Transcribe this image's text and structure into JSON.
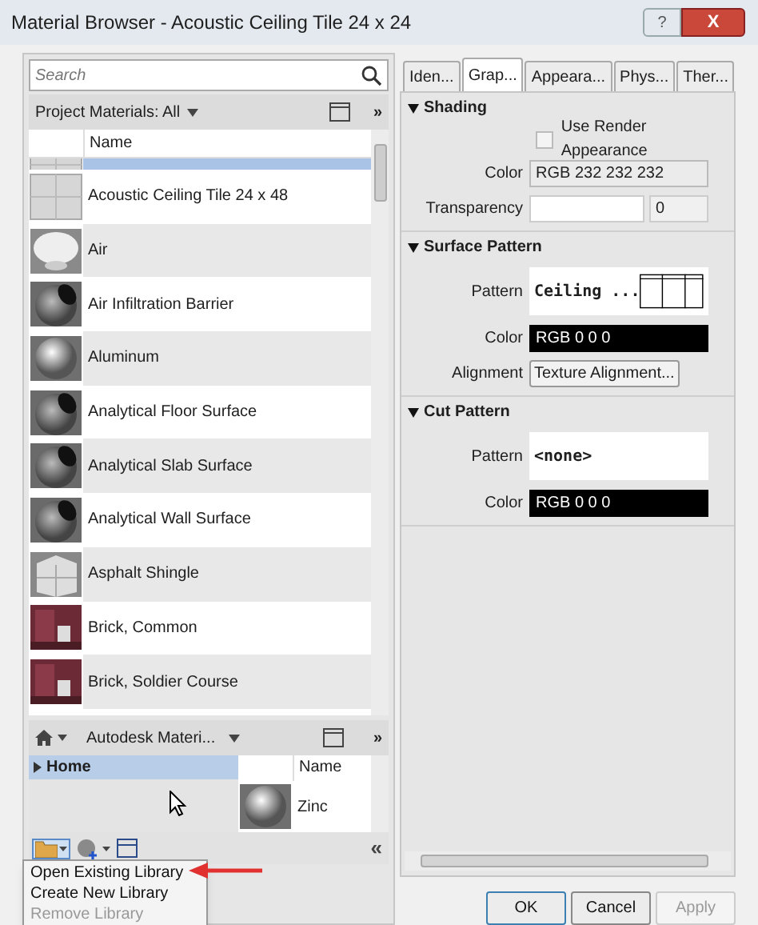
{
  "window": {
    "title": "Material Browser - Acoustic Ceiling Tile 24 x 24",
    "help": "?",
    "close": "X"
  },
  "search": {
    "placeholder": "Search"
  },
  "breadcrumb": {
    "label": "Project Materials: All",
    "more": "»"
  },
  "list": {
    "column": "Name",
    "rows": [
      {
        "kind": "tile",
        "selected": true
      },
      {
        "name": "Acoustic Ceiling Tile 24 x 48",
        "kind": "tile",
        "selected": false
      },
      {
        "name": "Air",
        "kind": "air",
        "selected": false
      },
      {
        "name": "Air Infiltration Barrier",
        "kind": "cutaway",
        "selected": false
      },
      {
        "name": "Aluminum",
        "kind": "sphere",
        "selected": false
      },
      {
        "name": "Analytical Floor Surface",
        "kind": "cutaway",
        "selected": false
      },
      {
        "name": "Analytical Slab Surface",
        "kind": "cutaway",
        "selected": false
      },
      {
        "name": "Analytical Wall Surface",
        "kind": "cutaway",
        "selected": false
      },
      {
        "name": "Asphalt Shingle",
        "kind": "block",
        "selected": false
      },
      {
        "name": "Brick, Common",
        "kind": "brick",
        "selected": false
      },
      {
        "name": "Brick, Soldier Course",
        "kind": "brick",
        "selected": false
      }
    ]
  },
  "library": {
    "breadcrumb": "Autodesk Materi...",
    "more": "»",
    "tree": [
      {
        "label": "Home",
        "selected": true,
        "expanded": false
      }
    ],
    "column": "Name",
    "rows": [
      {
        "name": "Zinc",
        "kind": "sphere"
      }
    ],
    "collapse": "«"
  },
  "tabs": [
    {
      "label": "Iden...",
      "selected": false
    },
    {
      "label": "Grap...",
      "selected": true
    },
    {
      "label": "Appeara...",
      "selected": false
    },
    {
      "label": "Phys...",
      "selected": false
    },
    {
      "label": "Ther...",
      "selected": false
    }
  ],
  "sections": [
    {
      "title": "Shading",
      "expanded": true,
      "fields": [
        {
          "kind": "checkbox",
          "label": "Use Render Appearance",
          "checked": false
        },
        {
          "kind": "color",
          "label": "Color",
          "value": "RGB 232 232 232",
          "dark": false
        },
        {
          "kind": "slider",
          "label": "Transparency",
          "value": "0",
          "level": 0
        }
      ]
    },
    {
      "title": "Surface Pattern",
      "expanded": true,
      "fields": [
        {
          "kind": "pattern",
          "label": "Pattern",
          "value": "Ceiling ...",
          "preview": true
        },
        {
          "kind": "color",
          "label": "Color",
          "value": "RGB 0 0 0",
          "dark": true
        },
        {
          "kind": "button",
          "label": "Alignment",
          "value": "Texture Alignment..."
        }
      ]
    },
    {
      "title": "Cut Pattern",
      "expanded": true,
      "fields": [
        {
          "kind": "pattern",
          "label": "Pattern",
          "value": "<none>",
          "preview": false
        },
        {
          "kind": "color",
          "label": "Color",
          "value": "RGB 0 0 0",
          "dark": true
        }
      ]
    }
  ],
  "menu": [
    {
      "label": "Open Existing Library",
      "disabled": false
    },
    {
      "label": "Create New Library",
      "disabled": false
    },
    {
      "label": "Remove Library",
      "disabled": true
    }
  ],
  "buttons": [
    {
      "label": "OK",
      "disabled": false,
      "default": true
    },
    {
      "label": "Cancel",
      "disabled": false,
      "default": false
    },
    {
      "label": "Apply",
      "disabled": true,
      "default": false
    }
  ]
}
